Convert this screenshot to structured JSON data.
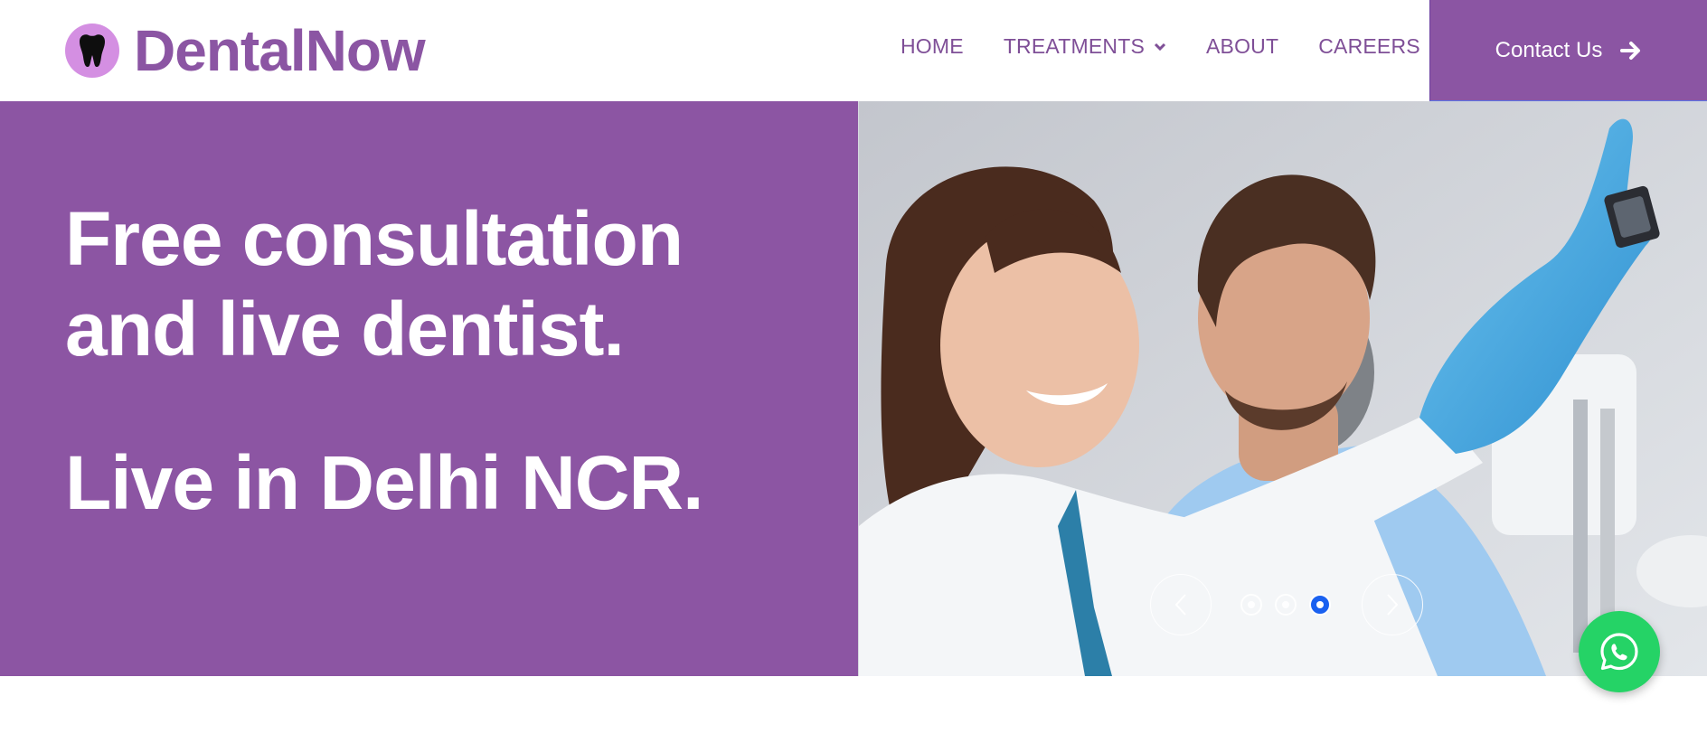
{
  "brand": {
    "name": "DentalNow",
    "logo_icon": "tooth-icon",
    "badge_color": "#d48fe2",
    "brand_color": "#8b55a3"
  },
  "nav": {
    "items": [
      {
        "label": "HOME"
      },
      {
        "label": "TREATMENTS",
        "icon": "chevron-down-icon"
      },
      {
        "label": "ABOUT"
      },
      {
        "label": "CAREERS"
      }
    ],
    "contact": {
      "label": "Contact Us",
      "icon": "arrow-right-icon"
    }
  },
  "hero": {
    "headline_line1": "Free consultation",
    "headline_line2": "and live dentist.",
    "subline": "Live in Delhi NCR.",
    "background_color": "#8c55a3",
    "image_alt": "dentist showing x-ray to smiling patient",
    "carousel": {
      "slide_count": 3,
      "active_slide": 3,
      "prev_icon": "chevron-left-icon",
      "next_icon": "chevron-right-icon"
    }
  },
  "whatsapp": {
    "icon": "whatsapp-icon",
    "color": "#25d366"
  }
}
